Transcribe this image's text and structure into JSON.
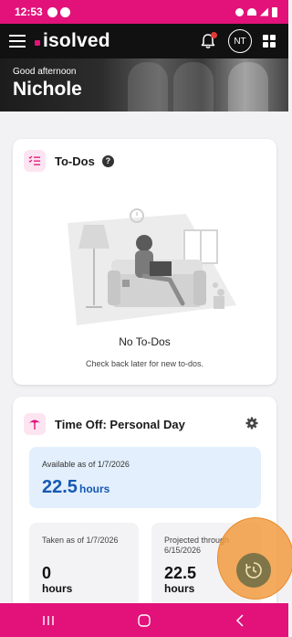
{
  "status_bar": {
    "time": "12:53"
  },
  "app_bar": {
    "logo_text": "isolved",
    "avatar_initials": "NT"
  },
  "hero": {
    "greeting": "Good afternoon",
    "name": "Nichole"
  },
  "todos": {
    "title": "To-Dos",
    "help_label": "?",
    "empty_title": "No To-Dos",
    "empty_subtitle": "Check back later for new to-dos."
  },
  "time_off": {
    "title": "Time Off: Personal Day",
    "available_label": "Available as of 1/7/2026",
    "available_value": "22.5",
    "available_unit": "hours",
    "taken_label": "Taken as of 1/7/2026",
    "taken_value": "0",
    "taken_unit": "hours",
    "projected_label": "Projected through 6/15/2026",
    "projected_value": "22.5",
    "projected_unit": "hours"
  },
  "colors": {
    "brand": "#e2127a",
    "accent_blue": "#1559b3",
    "fab": "#7f7548",
    "highlight": "#f2983a"
  },
  "icons": {
    "menu": "hamburger-icon",
    "notifications": "bell-icon",
    "apps": "grid-icon",
    "todos": "checklist-icon",
    "time_off": "beach-umbrella-icon",
    "settings": "gear-icon",
    "fab": "clock-refresh-icon",
    "nav": [
      "recent-apps-icon",
      "home-icon",
      "back-icon"
    ]
  }
}
